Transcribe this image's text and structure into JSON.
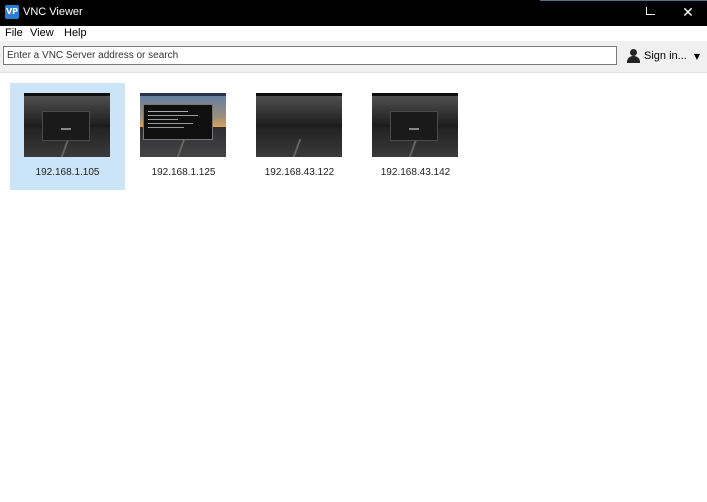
{
  "window": {
    "title": "VNC Viewer",
    "logo_text": "VP",
    "minimize_glyph": "",
    "close_glyph": "✕"
  },
  "menu": {
    "items": [
      "File",
      "View",
      "Help"
    ]
  },
  "toolbar": {
    "search_placeholder": "Enter a VNC Server address or search",
    "search_value": "",
    "signin_label": "Sign in...",
    "caret_glyph": "▼"
  },
  "connections": [
    {
      "label": "192.168.1.105",
      "selected": true
    },
    {
      "label": "192.168.1.125",
      "selected": false
    },
    {
      "label": "192.168.43.122",
      "selected": false
    },
    {
      "label": "192.168.43.142",
      "selected": false
    }
  ],
  "colors": {
    "titlebar": "#000000",
    "selection": "#cce4f7",
    "toolbar": "#f0f0f0",
    "logo": "#2a7fd4"
  },
  "icons": {
    "app": "vnc-logo-icon",
    "user": "user-icon",
    "dropdown": "chevron-down-icon"
  }
}
